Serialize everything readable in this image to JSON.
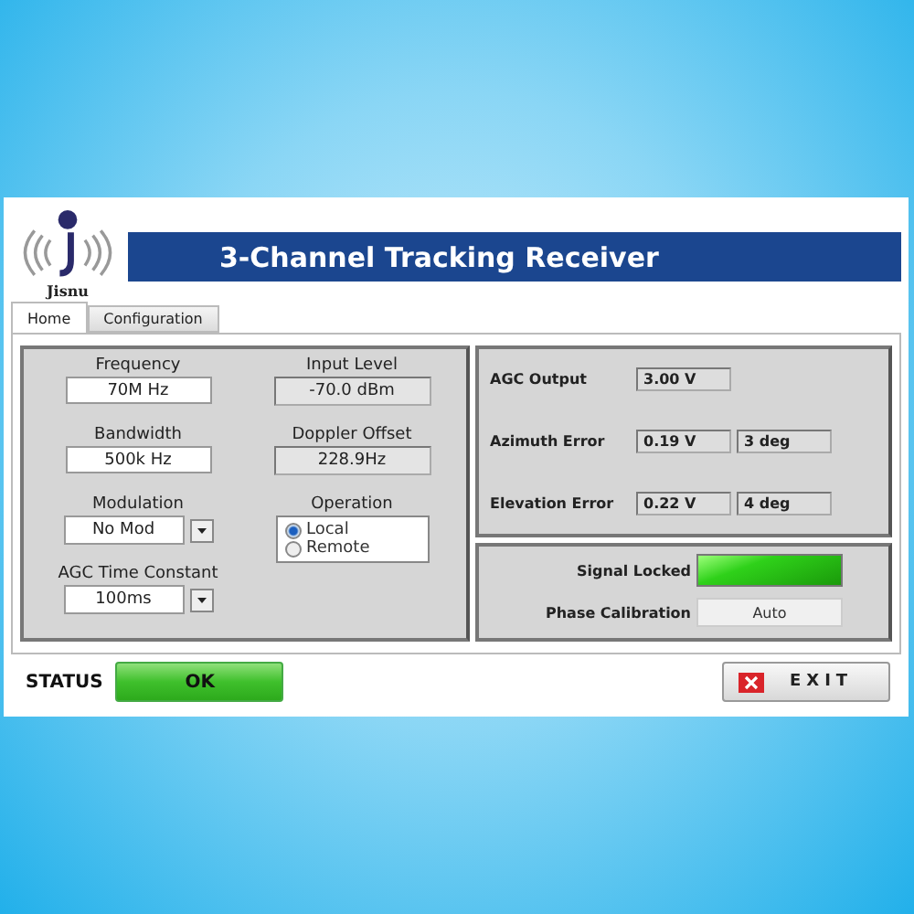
{
  "logo": {
    "text": "Jisnu"
  },
  "title": "3-Channel Tracking Receiver",
  "tabs": [
    {
      "label": "Home",
      "selected": true
    },
    {
      "label": "Configuration",
      "selected": false
    }
  ],
  "left_column": [
    {
      "kind": "input",
      "label": "Frequency",
      "value": "70M Hz"
    },
    {
      "kind": "input",
      "label": "Bandwidth",
      "value": "500k Hz"
    },
    {
      "kind": "dropdown",
      "label": "Modulation",
      "value": "No Mod"
    },
    {
      "kind": "dropdown",
      "label": "AGC Time Constant",
      "value": "100ms"
    }
  ],
  "right_column": [
    {
      "kind": "indicator",
      "label": "Input Level",
      "value": "-70.0 dBm"
    },
    {
      "kind": "indicator",
      "label": "Doppler Offset",
      "value": "228.9Hz"
    },
    {
      "kind": "radio",
      "label": "Operation",
      "options": [
        {
          "label": "Local",
          "selected": true
        },
        {
          "label": "Remote",
          "selected": false
        }
      ]
    }
  ],
  "readouts": [
    {
      "label": "AGC Output",
      "values": [
        "3.00 V"
      ]
    },
    {
      "label": "Azimuth Error",
      "values": [
        "0.19 V",
        "3 deg"
      ]
    },
    {
      "label": "Elevation Error",
      "values": [
        "0.22 V",
        "4 deg"
      ]
    }
  ],
  "signal_locked": {
    "label": "Signal Locked",
    "on": true
  },
  "phase_calibration": {
    "label": "Phase Calibration",
    "value": "Auto"
  },
  "status": {
    "label": "STATUS",
    "value": "OK"
  },
  "exit_button": {
    "label": "EXIT"
  }
}
